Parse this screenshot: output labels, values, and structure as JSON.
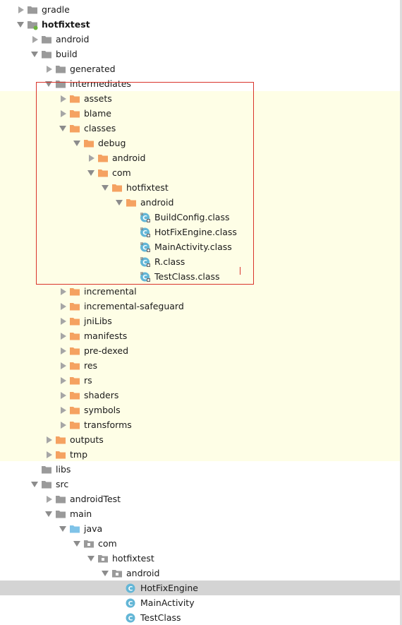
{
  "colors": {
    "folder": "#f4a261",
    "folder_grey": "#9a9a9a",
    "folder_source": "#7fc3e8",
    "class_icon": "#63b6d6",
    "module_dot": "#6cb33f",
    "highlight_box": "#d9342b",
    "selection": "#d4d4d4",
    "band": "#fefee6"
  },
  "tree": [
    {
      "label": "gradle",
      "arrow": "right",
      "icon": "folder-grey-icon"
    },
    {
      "label": "hotfixtest",
      "arrow": "down",
      "icon": "module-folder-icon",
      "bold": true
    },
    {
      "label": "android",
      "arrow": "right",
      "icon": "folder-grey-icon"
    },
    {
      "label": "build",
      "arrow": "down",
      "icon": "folder-grey-icon"
    },
    {
      "label": "generated",
      "arrow": "right",
      "icon": "folder-grey-icon"
    },
    {
      "label": "intermediates",
      "arrow": "down",
      "icon": "folder-grey-icon"
    },
    {
      "label": "assets",
      "arrow": "right",
      "icon": "folder-icon"
    },
    {
      "label": "blame",
      "arrow": "right",
      "icon": "folder-icon"
    },
    {
      "label": "classes",
      "arrow": "down",
      "icon": "folder-icon"
    },
    {
      "label": "debug",
      "arrow": "down",
      "icon": "folder-icon"
    },
    {
      "label": "android",
      "arrow": "right",
      "icon": "folder-icon"
    },
    {
      "label": "com",
      "arrow": "down",
      "icon": "folder-icon"
    },
    {
      "label": "hotfixtest",
      "arrow": "down",
      "icon": "folder-icon"
    },
    {
      "label": "android",
      "arrow": "down",
      "icon": "folder-icon"
    },
    {
      "label": "BuildConfig.class",
      "arrow": "none",
      "icon": "class-file-icon"
    },
    {
      "label": "HotFixEngine.class",
      "arrow": "none",
      "icon": "class-file-icon"
    },
    {
      "label": "MainActivity.class",
      "arrow": "none",
      "icon": "class-file-icon"
    },
    {
      "label": "R.class",
      "arrow": "none",
      "icon": "class-file-icon"
    },
    {
      "label": "TestClass.class",
      "arrow": "none",
      "icon": "class-file-icon"
    },
    {
      "label": "incremental",
      "arrow": "right",
      "icon": "folder-icon"
    },
    {
      "label": "incremental-safeguard",
      "arrow": "right",
      "icon": "folder-icon"
    },
    {
      "label": "jniLibs",
      "arrow": "right",
      "icon": "folder-icon"
    },
    {
      "label": "manifests",
      "arrow": "right",
      "icon": "folder-icon"
    },
    {
      "label": "pre-dexed",
      "arrow": "right",
      "icon": "folder-icon"
    },
    {
      "label": "res",
      "arrow": "right",
      "icon": "folder-icon"
    },
    {
      "label": "rs",
      "arrow": "right",
      "icon": "folder-icon"
    },
    {
      "label": "shaders",
      "arrow": "right",
      "icon": "folder-icon"
    },
    {
      "label": "symbols",
      "arrow": "right",
      "icon": "folder-icon"
    },
    {
      "label": "transforms",
      "arrow": "right",
      "icon": "folder-icon"
    },
    {
      "label": "outputs",
      "arrow": "right",
      "icon": "folder-icon"
    },
    {
      "label": "tmp",
      "arrow": "right",
      "icon": "folder-icon"
    },
    {
      "label": "libs",
      "arrow": "none",
      "icon": "folder-grey-icon"
    },
    {
      "label": "src",
      "arrow": "down",
      "icon": "folder-grey-icon"
    },
    {
      "label": "androidTest",
      "arrow": "right",
      "icon": "folder-grey-icon"
    },
    {
      "label": "main",
      "arrow": "down",
      "icon": "folder-grey-icon"
    },
    {
      "label": "java",
      "arrow": "down",
      "icon": "source-folder-icon"
    },
    {
      "label": "com",
      "arrow": "down",
      "icon": "package-icon"
    },
    {
      "label": "hotfixtest",
      "arrow": "down",
      "icon": "package-icon"
    },
    {
      "label": "android",
      "arrow": "down",
      "icon": "package-icon"
    },
    {
      "label": "HotFixEngine",
      "arrow": "none",
      "icon": "java-class-icon",
      "selected": true
    },
    {
      "label": "MainActivity",
      "arrow": "none",
      "icon": "java-class-icon"
    },
    {
      "label": "TestClass",
      "arrow": "none",
      "icon": "java-class-icon"
    }
  ]
}
